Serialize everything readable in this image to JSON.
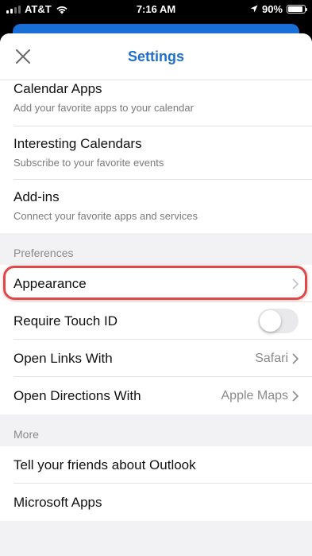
{
  "status_bar": {
    "carrier": "AT&T",
    "time": "7:16 AM",
    "battery": "90%",
    "battery_level": 0.9,
    "icons": [
      "signal-icon",
      "wifi-icon",
      "location-icon",
      "battery-icon"
    ]
  },
  "header": {
    "title": "Settings",
    "close_icon": "close-icon"
  },
  "accounts_group": {
    "items": [
      {
        "title": "Calendar Apps",
        "subtitle": "Add your favorite apps to your calendar"
      },
      {
        "title": "Interesting Calendars",
        "subtitle": "Subscribe to your favorite events"
      },
      {
        "title": "Add-ins",
        "subtitle": "Connect your favorite apps and services"
      }
    ]
  },
  "preferences": {
    "header": "Preferences",
    "appearance": {
      "title": "Appearance"
    },
    "touch_id": {
      "title": "Require Touch ID",
      "enabled": false
    },
    "open_links": {
      "title": "Open Links With",
      "value": "Safari"
    },
    "open_directions": {
      "title": "Open Directions With",
      "value": "Apple Maps"
    }
  },
  "more": {
    "header": "More",
    "items": [
      {
        "title": "Tell your friends about Outlook"
      },
      {
        "title": "Microsoft Apps"
      }
    ]
  },
  "colors": {
    "accent": "#1f6fd0",
    "highlight": "#e04848",
    "background": "#f2f2f4"
  }
}
